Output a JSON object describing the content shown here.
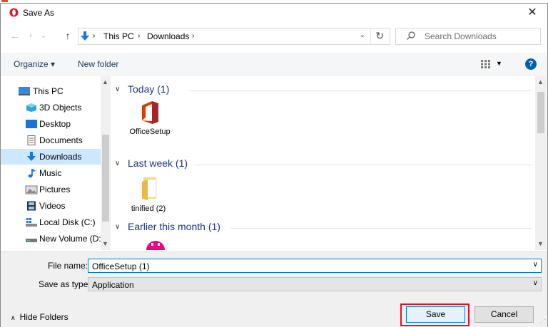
{
  "dialog": {
    "title": "Save As",
    "close_symbol": "✕"
  },
  "address": {
    "crumbs": [
      "This PC",
      "Downloads"
    ],
    "search_placeholder": "Search Downloads"
  },
  "toolbar": {
    "organize_label": "Organize ▾",
    "new_folder_label": "New folder",
    "help_label": "?"
  },
  "sidebar": {
    "items": [
      {
        "label": "This PC",
        "icon": "monitor-icon"
      },
      {
        "label": "3D Objects",
        "icon": "cube-icon"
      },
      {
        "label": "Desktop",
        "icon": "desktop-icon"
      },
      {
        "label": "Documents",
        "icon": "document-icon"
      },
      {
        "label": "Downloads",
        "icon": "download-arrow-icon",
        "selected": true
      },
      {
        "label": "Music",
        "icon": "music-note-icon"
      },
      {
        "label": "Pictures",
        "icon": "picture-icon"
      },
      {
        "label": "Videos",
        "icon": "film-icon"
      },
      {
        "label": "Local Disk (C:)",
        "icon": "windows-drive-icon"
      },
      {
        "label": "New Volume (D:",
        "icon": "drive-icon"
      }
    ]
  },
  "groups": [
    {
      "title": "Today (1)",
      "files": [
        {
          "label": "OfficeSetup",
          "icon": "office-logo-icon"
        }
      ]
    },
    {
      "title": "Last week (1)",
      "files": [
        {
          "label": "tinified (2)",
          "icon": "folder-icon"
        }
      ]
    },
    {
      "title": "Earlier this month (1)",
      "files": [
        {
          "label": "",
          "icon": "pink-app-icon"
        }
      ]
    }
  ],
  "fields": {
    "file_name_label": "File name:",
    "file_name_value": "OfficeSetup (1)",
    "save_type_label": "Save as type:",
    "save_type_value": "Application"
  },
  "footer": {
    "hide_folders_label": "Hide Folders",
    "save_label": "Save",
    "cancel_label": "Cancel"
  },
  "colors": {
    "accent": "#0078d7",
    "highlight": "#e81123",
    "selected": "#cce8ff"
  }
}
